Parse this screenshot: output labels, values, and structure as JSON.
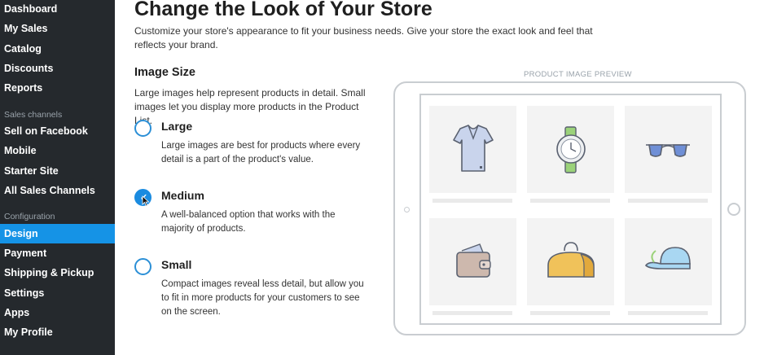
{
  "sidebar": {
    "items_top": [
      "Dashboard",
      "My Sales",
      "Catalog",
      "Discounts",
      "Reports"
    ],
    "sales_channels_header": "Sales channels",
    "items_sales": [
      "Sell on Facebook",
      "Mobile",
      "Starter Site",
      "All Sales Channels"
    ],
    "configuration_header": "Configuration",
    "items_config": [
      "Design",
      "Payment",
      "Shipping & Pickup",
      "Settings",
      "Apps",
      "My Profile"
    ],
    "active": "Design",
    "active_color": "#1593e6",
    "background": "#25292d"
  },
  "main": {
    "title": "Change the Look of Your Store",
    "description": "Customize your store's appearance to fit your business needs. Give your store the exact look and feel that reflects your brand.",
    "image_size": {
      "title": "Image Size",
      "description": "Large images help represent products in detail. Small images let you display more products in the Product List.",
      "selected": "Medium",
      "options": [
        {
          "label": "Large",
          "description": "Large images are best for products where every detail is a part of the product's value."
        },
        {
          "label": "Medium",
          "description": "A well-balanced option that works with the majority of products."
        },
        {
          "label": "Small",
          "description": "Compact images reveal less detail, but allow you to fit in more products for your customers to see on the screen."
        }
      ]
    }
  },
  "preview": {
    "label": "PRODUCT IMAGE PREVIEW",
    "products": [
      "t-shirt-icon",
      "watch-icon",
      "sunglasses-icon",
      "wallet-icon",
      "bag-icon",
      "cap-icon"
    ]
  }
}
